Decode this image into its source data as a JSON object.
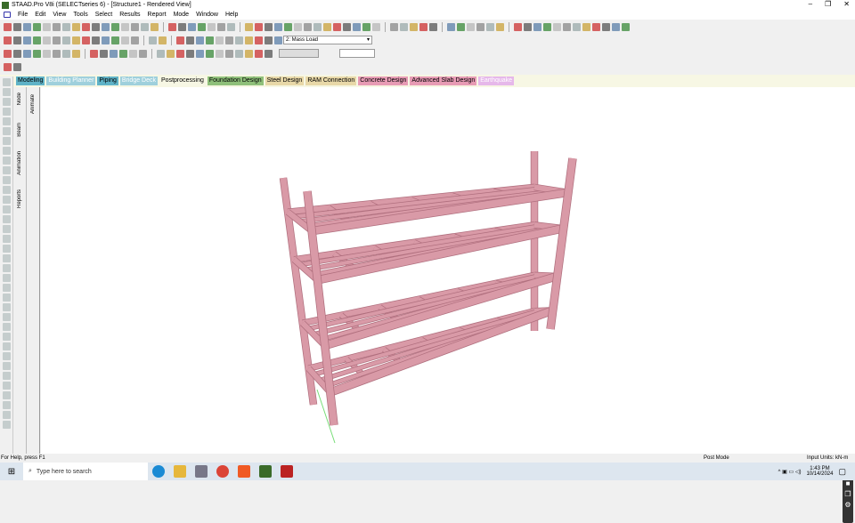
{
  "window": {
    "title": "STAAD.Pro V8i (SELECTseries 6) - [Structure1 - Rendered View]",
    "minimize": "–",
    "maximize": "❐",
    "close": "✕"
  },
  "menu": [
    "File",
    "Edit",
    "View",
    "Tools",
    "Select",
    "Results",
    "Report",
    "Mode",
    "Window",
    "Help"
  ],
  "toolbar": {
    "load_case": "2: Mass Load"
  },
  "tabs": [
    {
      "label": "Modeling",
      "bg": "#5fb3c7"
    },
    {
      "label": "Building Planner",
      "bg": "#9fd0dc",
      "fg": "#fff"
    },
    {
      "label": "Piping",
      "bg": "#5fb3c7"
    },
    {
      "label": "Bridge Deck",
      "bg": "#9fd0dc",
      "fg": "#fff"
    },
    {
      "label": "Postprocessing",
      "bg": "#f7f7e4"
    },
    {
      "label": "Foundation Design",
      "bg": "#8fc07a"
    },
    {
      "label": "Steel Design",
      "bg": "#e8d8a8"
    },
    {
      "label": "RAM Connection",
      "bg": "#e8d8a8"
    },
    {
      "label": "Concrete Design",
      "bg": "#e79bb4"
    },
    {
      "label": "Advanced Slab Design",
      "bg": "#e79bb4"
    },
    {
      "label": "Earthquake",
      "bg": "#e6b8ea",
      "fg": "#fff"
    }
  ],
  "side_tabs": {
    "node": "Node",
    "beam": "Beam",
    "animation": "Animation",
    "reports": "Reports",
    "animate": "Animate"
  },
  "status": {
    "help": "For Help, press F1",
    "mode": "Post Mode",
    "units": "Input Units:  kN-m"
  },
  "taskbar": {
    "search_placeholder": "Type here to search",
    "time": "1:43 PM",
    "date": "10/14/2024"
  },
  "colors": {
    "member": "#d99aa7",
    "member_dark": "#b06f7e"
  }
}
